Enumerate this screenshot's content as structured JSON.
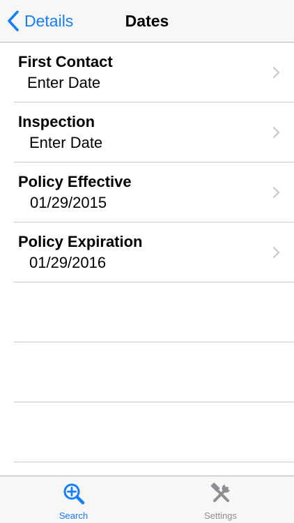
{
  "navbar": {
    "back_label": "Details",
    "title": "Dates",
    "back_icon": "chevron-left-icon"
  },
  "rows": [
    {
      "title": "First Contact",
      "value": "Enter Date"
    },
    {
      "title": "Inspection",
      "value": "Enter Date"
    },
    {
      "title": "Policy Effective",
      "value": "01/29/2015"
    },
    {
      "title": "Policy Expiration",
      "value": "01/29/2016"
    }
  ],
  "tabbar": {
    "tabs": [
      {
        "label": "Search",
        "icon": "search-plus-icon",
        "selected": true
      },
      {
        "label": "Settings",
        "icon": "tools-icon",
        "selected": false
      }
    ]
  },
  "colors": {
    "accent": "#157efb",
    "inactive": "#8e8e93",
    "separator": "#c8c7cc",
    "bar_background": "#f7f7f8"
  }
}
